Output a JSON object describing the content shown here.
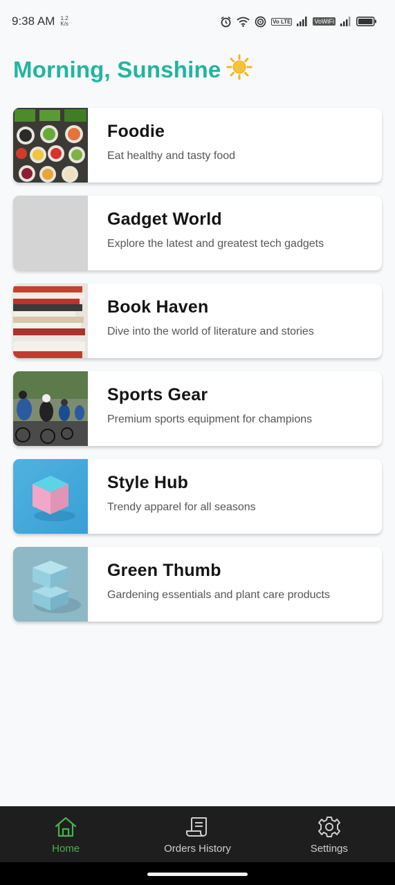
{
  "status_bar": {
    "time": "9:38 AM",
    "net_speed_value": "1.2",
    "net_speed_unit": "K/s",
    "volte_badge": "Vo LTE",
    "vowifi_badge": "VoWiFi"
  },
  "greeting": {
    "text": "Morning, Sunshine",
    "emoji": "☀️"
  },
  "cards": [
    {
      "title": "Foodie",
      "description": "Eat healthy and tasty food",
      "image": "vegetable-bowls-photo"
    },
    {
      "title": "Gadget World",
      "description": "Explore the latest and greatest tech gadgets",
      "image": "gray-placeholder"
    },
    {
      "title": "Book Haven",
      "description": "Dive into the world of literature and stories",
      "image": "book-stack-photo"
    },
    {
      "title": "Sports Gear",
      "description": "Premium sports equipment for champions",
      "image": "cyclists-photo"
    },
    {
      "title": "Style Hub",
      "description": "Trendy apparel for all seasons",
      "image": "pink-cube-photo"
    },
    {
      "title": "Green Thumb",
      "description": "Gardening essentials and plant care products",
      "image": "blue-cubes-photo"
    }
  ],
  "bottom_nav": {
    "items": [
      {
        "label": "Home",
        "icon": "home-icon",
        "active": true
      },
      {
        "label": "Orders History",
        "icon": "receipt-icon",
        "active": false
      },
      {
        "label": "Settings",
        "icon": "gear-icon",
        "active": false
      }
    ]
  },
  "colors": {
    "greeting": "#1fb5a0",
    "nav_active": "#4caf50",
    "nav_background": "#1e1e1e",
    "page_background": "#f8f9fb"
  }
}
